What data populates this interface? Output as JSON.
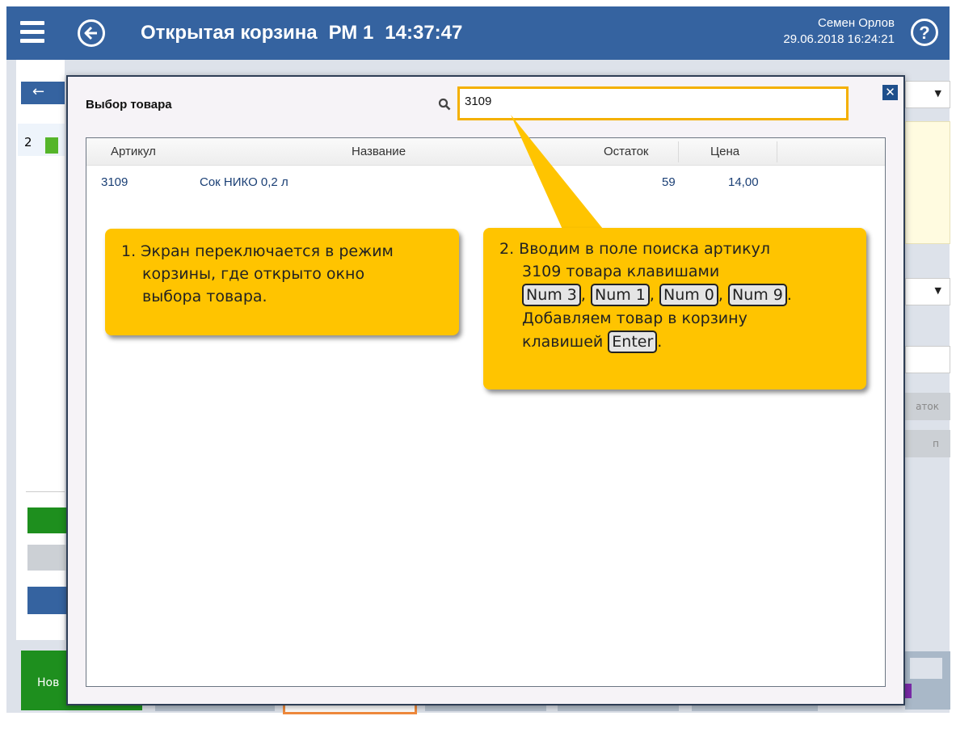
{
  "header": {
    "title": "Открытая корзина",
    "workstation": "РМ 1",
    "time": "14:37:47",
    "user_name": "Семен Орлов",
    "datetime": "29.06.2018 16:24:21",
    "help_label": "?",
    "menu_icon": "menu-icon",
    "back_icon": "back-arrow-icon"
  },
  "background": {
    "left_back_label": "←",
    "basket_item_number": "2",
    "new_button_label": "Нов",
    "right_button_1": "аток",
    "right_button_2": "п"
  },
  "dialog": {
    "title": "Выбор товара",
    "search_value": "3109",
    "close_label": "✕",
    "columns": [
      "Артикул",
      "Название",
      "Остаток",
      "Цена"
    ],
    "rows": [
      {
        "article": "3109",
        "name": "Сок НИКО 0,2 л",
        "stock": "59",
        "price": "14,00"
      }
    ]
  },
  "callouts": {
    "first": {
      "line1": "1. Экран переключается в режим",
      "line2": "корзины, где открыто окно",
      "line3": "выбора товара."
    },
    "second": {
      "line1": "2. Вводим в поле поиска артикул",
      "line2": "3109 товара клавишами",
      "keys": [
        "Num 3",
        "Num 1",
        "Num 0",
        "Num 9"
      ],
      "line4": "Добавляем товар в корзину",
      "line5_prefix": "клавишей",
      "enter_key": "Enter"
    }
  },
  "colors": {
    "header_bg": "#3563a0",
    "callout": "#ffc400",
    "search_border": "#f4b000",
    "link_text": "#1a3f75"
  }
}
